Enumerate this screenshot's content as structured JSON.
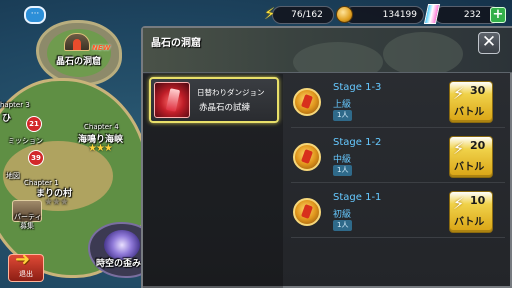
{
  "hud": {
    "stamina": "76/162",
    "coins": "134199",
    "crystals": "232",
    "stamina_icon": "lightning-bolt",
    "coin_icon": "gold-coin",
    "crystal_icon": "rainbow-crystal",
    "plus_label": "+"
  },
  "map": {
    "cave_label": "晶石の洞窟",
    "new_badge": "NEW",
    "chapter3": "hapter 3",
    "chapter3_place": "ひ",
    "mission_label": "ミッション",
    "mission_badge": "21",
    "chapter4": "Chapter 4",
    "chapter4_place": "海鳴り海峡",
    "chapter4_stars": "★★★",
    "chapter1_small": "地図",
    "chapter1": "Chapter 1",
    "chapter1_place": "まりの村",
    "party_badge": "39",
    "party_label": "パーティ",
    "recruit_label": "募集",
    "rift_label": "時空の歪み",
    "extra_stars": "★★★"
  },
  "panel": {
    "title": "晶石の洞窟",
    "close_label": "✕",
    "side_item": {
      "sub": "日替わりダンジョン",
      "main": "赤晶石の試練"
    },
    "stages": [
      {
        "name": "Stage 1-3",
        "difficulty": "上級",
        "players": "1人",
        "cost": "30",
        "battle": "バトル"
      },
      {
        "name": "Stage 1-2",
        "difficulty": "中級",
        "players": "1人",
        "cost": "20",
        "battle": "バトル"
      },
      {
        "name": "Stage 1-1",
        "difficulty": "初級",
        "players": "1人",
        "cost": "10",
        "battle": "バトル"
      }
    ]
  },
  "exit": {
    "label": "退出"
  },
  "colors": {
    "stage_text": "#66c9ff",
    "battle_button": "#f0d24a",
    "selected_border": "#e9e06a"
  }
}
